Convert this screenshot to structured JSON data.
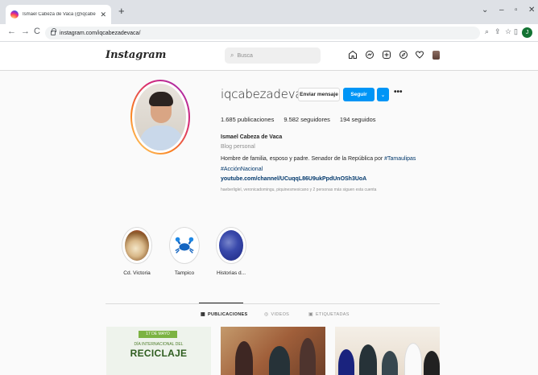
{
  "browser": {
    "tab_title": "Ismael Cabeza de Vaca (@iqcabe",
    "tab_close": "✕",
    "new_tab": "+",
    "url": "instagram.com/iqcabezadevaca/",
    "win_minimize": "–",
    "win_restore": "▫",
    "win_close": "✕",
    "back": "←",
    "forward": "→",
    "reload": "C",
    "profile_initial": "J"
  },
  "header": {
    "logo": "Instagram",
    "search_placeholder": "Busca",
    "search_icon": "⌕"
  },
  "profile": {
    "username": "iqcabezadevaca",
    "message_button": "Enviar mensaje",
    "follow_button": "Seguir",
    "dropdown_button": "⌄",
    "more_button": "•••",
    "posts_count": "1.685",
    "posts_label": "publicaciones",
    "followers_count": "9.582",
    "followers_label": "seguidores",
    "following_count": "194",
    "following_label": "seguidos",
    "full_name": "Ismael Cabeza de Vaca",
    "category": "Blog personal",
    "bio_text": "Hombre de familia, esposo y padre. Senador de la República por",
    "bio_tag1": "#Tamaulipas",
    "bio_tag2": "#AcciónNacional",
    "bio_link": "youtube.com/channel/UCuqqL86U9ukPpdUnOSh3UoA",
    "followed_by": "haeberliglel, veronicadomingu, piquinesmexicano y 2 personas más siguen esta cuenta"
  },
  "highlights": [
    {
      "label": "Cd. Victoria",
      "icon": "food-icon"
    },
    {
      "label": "Tampico",
      "icon": "crab-icon"
    },
    {
      "label": "Historias d...",
      "icon": "people-icon"
    }
  ],
  "tabs": [
    {
      "label": "PUBLICACIONES",
      "icon": "grid-icon",
      "active": true
    },
    {
      "label": "VIDEOS",
      "icon": "video-icon",
      "active": false
    },
    {
      "label": "ETIQUETADAS",
      "icon": "tag-icon",
      "active": false
    }
  ],
  "posts": [
    {
      "badge": "17 DE MAYO",
      "subtitle": "DÍA INTERNACIONAL DEL",
      "title": "RECICLAJE"
    }
  ],
  "colors": {
    "follow_blue": "#0095f6",
    "link_blue": "#00376b",
    "recycle_green": "#7cb342"
  }
}
